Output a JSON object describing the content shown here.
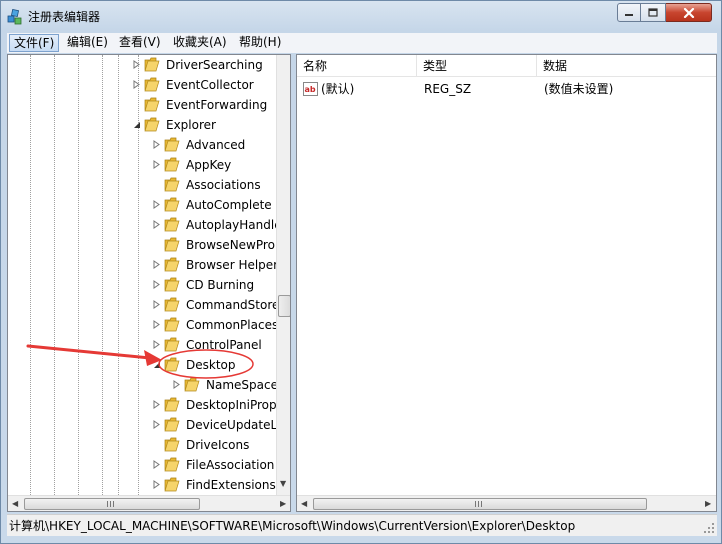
{
  "window": {
    "title": "注册表编辑器",
    "icon": "registry-editor-icon"
  },
  "caption_buttons": {
    "minimize": "minimize-icon",
    "maximize": "maximize-icon",
    "close": "close-icon"
  },
  "menu": {
    "file": "文件(F)",
    "edit": "编辑(E)",
    "view": "查看(V)",
    "favorites": "收藏夹(A)",
    "help": "帮助(H)"
  },
  "tree": {
    "items": [
      {
        "label": "DriverSearching",
        "level": 0,
        "expander": "collapsed"
      },
      {
        "label": "EventCollector",
        "level": 0,
        "expander": "collapsed"
      },
      {
        "label": "EventForwarding",
        "level": 0,
        "expander": "none"
      },
      {
        "label": "Explorer",
        "level": 0,
        "expander": "expanded"
      },
      {
        "label": "Advanced",
        "level": 1,
        "expander": "collapsed"
      },
      {
        "label": "AppKey",
        "level": 1,
        "expander": "collapsed"
      },
      {
        "label": "Associations",
        "level": 1,
        "expander": "none"
      },
      {
        "label": "AutoComplete",
        "level": 1,
        "expander": "collapsed"
      },
      {
        "label": "AutoplayHandle",
        "level": 1,
        "expander": "collapsed"
      },
      {
        "label": "BrowseNewPro",
        "level": 1,
        "expander": "none"
      },
      {
        "label": "Browser Helper",
        "level": 1,
        "expander": "collapsed"
      },
      {
        "label": "CD Burning",
        "level": 1,
        "expander": "collapsed"
      },
      {
        "label": "CommandStore",
        "level": 1,
        "expander": "collapsed"
      },
      {
        "label": "CommonPlaces",
        "level": 1,
        "expander": "collapsed"
      },
      {
        "label": "ControlPanel",
        "level": 1,
        "expander": "collapsed"
      },
      {
        "label": "Desktop",
        "level": 1,
        "expander": "expanded",
        "selected": true
      },
      {
        "label": "NameSpace",
        "level": 2,
        "expander": "collapsed"
      },
      {
        "label": "DesktopIniProp",
        "level": 1,
        "expander": "collapsed"
      },
      {
        "label": "DeviceUpdateL",
        "level": 1,
        "expander": "collapsed"
      },
      {
        "label": "DriveIcons",
        "level": 1,
        "expander": "none"
      },
      {
        "label": "FileAssociation",
        "level": 1,
        "expander": "collapsed"
      },
      {
        "label": "FindExtensions",
        "level": 1,
        "expander": "collapsed"
      }
    ]
  },
  "list": {
    "columns": {
      "name": "名称",
      "type": "类型",
      "data": "数据"
    },
    "rows": [
      {
        "name": "(默认)",
        "type": "REG_SZ",
        "data": "(数值未设置)",
        "icon": "string-value-icon"
      }
    ]
  },
  "status": {
    "path": "计算机\\HKEY_LOCAL_MACHINE\\SOFTWARE\\Microsoft\\Windows\\CurrentVersion\\Explorer\\Desktop"
  },
  "colors": {
    "annotation_red": "#e53935",
    "folder_yellow": "#f2c94c",
    "close_red": "#c8452f"
  }
}
